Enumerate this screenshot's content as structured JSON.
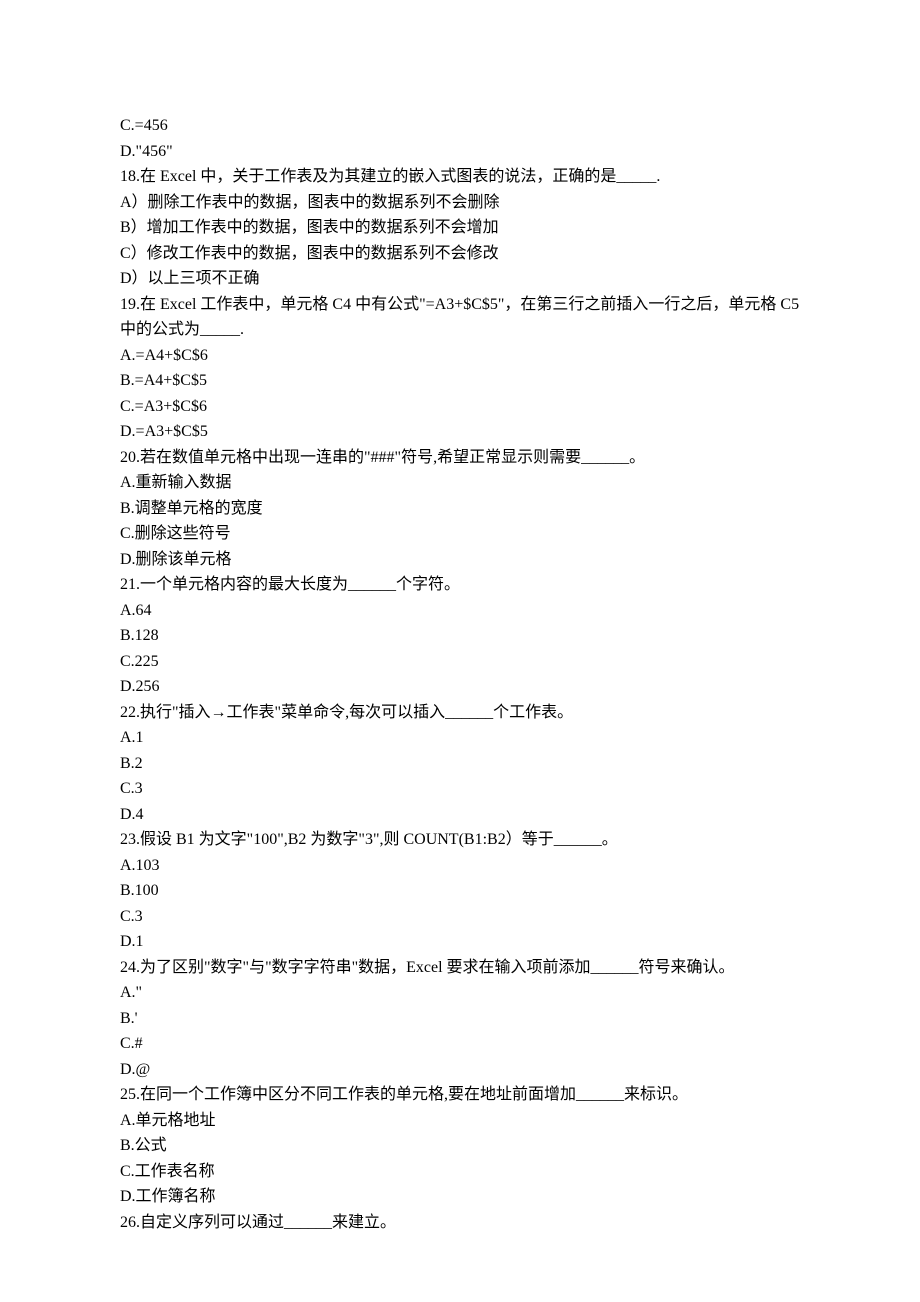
{
  "lines": [
    "C.=456",
    "D.\"456\"",
    "18.在 Excel 中，关于工作表及为其建立的嵌入式图表的说法，正确的是_____.",
    "A）删除工作表中的数据，图表中的数据系列不会删除",
    "B）增加工作表中的数据，图表中的数据系列不会增加",
    "C）修改工作表中的数据，图表中的数据系列不会修改",
    "D）以上三项不正确",
    "19.在 Excel 工作表中，单元格 C4 中有公式\"=A3+$C$5\"，在第三行之前插入一行之后，单元格 C5 中的公式为_____.",
    "A.=A4+$C$6",
    "B.=A4+$C$5",
    "C.=A3+$C$6",
    "D.=A3+$C$5",
    "20.若在数值单元格中出现一连串的\"###\"符号,希望正常显示则需要______。",
    "A.重新输入数据",
    "B.调整单元格的宽度",
    "C.删除这些符号",
    "D.删除该单元格",
    "21.一个单元格内容的最大长度为______个字符。",
    "A.64",
    "B.128",
    "C.225",
    "D.256",
    "22.执行\"插入→工作表\"菜单命令,每次可以插入______个工作表。",
    "A.1",
    "B.2",
    "C.3",
    "D.4",
    "23.假设 B1 为文字\"100\",B2 为数字\"3\",则 COUNT(B1:B2）等于______。",
    "A.103",
    "B.100",
    "C.3",
    "D.1",
    "24.为了区别\"数字\"与\"数字字符串\"数据，Excel 要求在输入项前添加______符号来确认。",
    "A.\"",
    "B.'",
    "C.#",
    "D.@",
    "25.在同一个工作簿中区分不同工作表的单元格,要在地址前面增加______来标识。",
    "A.单元格地址",
    "B.公式",
    "C.工作表名称",
    "D.工作簿名称",
    "26.自定义序列可以通过______来建立。"
  ]
}
